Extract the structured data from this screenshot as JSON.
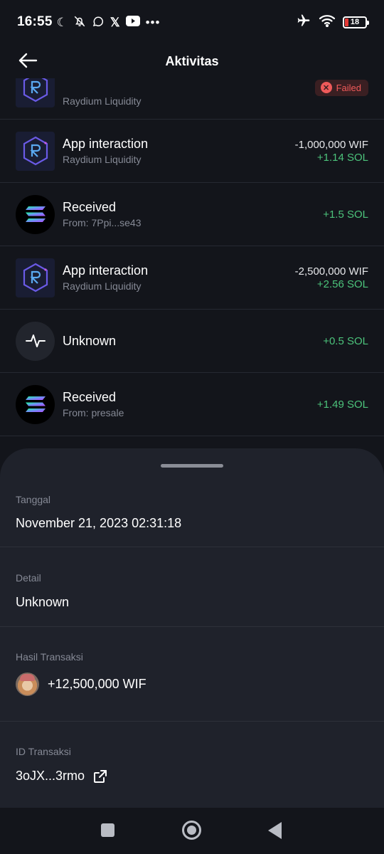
{
  "status_bar": {
    "time": "16:55",
    "left_icons": [
      "moon-icon",
      "bell-off-icon",
      "whatsapp-icon",
      "x-icon",
      "youtube-icon",
      "more-dots-icon"
    ],
    "right_icons": [
      "airplane-icon",
      "wifi-icon",
      "battery-icon"
    ],
    "battery_level": "18"
  },
  "header": {
    "title": "Aktivitas"
  },
  "transactions": [
    {
      "icon": "raydium-icon",
      "title": "",
      "subtitle": "Raydium Liquidity",
      "status": "Failed"
    },
    {
      "icon": "raydium-icon",
      "title": "App interaction",
      "subtitle": "Raydium Liquidity",
      "amount_out": "-1,000,000 WIF",
      "amount_in": "+1.14 SOL"
    },
    {
      "icon": "solana-icon",
      "title": "Received",
      "subtitle": "From: 7Ppi...se43",
      "amount_in": "+1.5 SOL"
    },
    {
      "icon": "raydium-icon",
      "title": "App interaction",
      "subtitle": "Raydium Liquidity",
      "amount_out": "-2,500,000 WIF",
      "amount_in": "+2.56 SOL"
    },
    {
      "icon": "pulse-icon",
      "title": "Unknown",
      "amount_in": "+0.5 SOL"
    },
    {
      "icon": "solana-icon",
      "title": "Received",
      "subtitle": "From: presale",
      "amount_in": "+1.49 SOL"
    }
  ],
  "detail_sheet": {
    "date_label": "Tanggal",
    "date_value": "November 21, 2023 02:31:18",
    "detail_label": "Detail",
    "detail_value": "Unknown",
    "result_label": "Hasil Transaksi",
    "result_value": "+12,500,000 WIF",
    "result_icon": "wif-token-icon",
    "txid_label": "ID Transaksi",
    "txid_value": "3oJX...3rmo",
    "txid_icon": "external-link-icon"
  },
  "colors": {
    "background": "#13151b",
    "sheet": "#1f222b",
    "positive": "#4cc37b",
    "failed": "#f05a5a"
  }
}
